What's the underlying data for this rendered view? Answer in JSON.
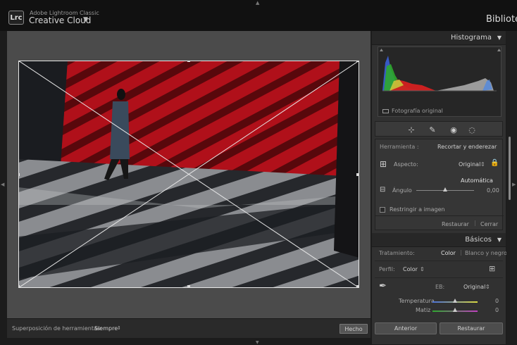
{
  "app": {
    "logo": "Lrc",
    "brand_small": "Adobe Lightroom Classic",
    "brand_main": "Creative Cloud",
    "brand_caret": "▼",
    "module": "Bibliotec"
  },
  "toolbar": {
    "overlay_label": "Superposición de herramientas:",
    "overlay_value": "Siempre",
    "overlay_caret": "⇕",
    "done_label": "Hecho"
  },
  "histogram": {
    "header": "Histograma",
    "caption": "Fotografía original",
    "colors": {
      "red": "#d42020",
      "green": "#2ea82e",
      "blue": "#3b5fd6",
      "yellow": "#c8c83a",
      "gray": "#a8a8a8"
    }
  },
  "tools": {
    "icons": [
      "crop-icon",
      "heal-icon",
      "redeye-icon",
      "mask-icon"
    ]
  },
  "crop": {
    "tool_label": "Herramienta :",
    "tool_value": "Recortar y enderezar",
    "aspect_label": "Aspecto:",
    "aspect_value": "Original",
    "aspect_caret": "⇕",
    "auto_label": "Automática",
    "angle_label": "Ángulo",
    "angle_value": "0,00",
    "angle_fraction": 0.5,
    "restrict_label": "Restringir a imagen",
    "reset_label": "Restaurar",
    "close_label": "Cerrar"
  },
  "basics": {
    "header": "Básicos",
    "treatment_label": "Tratamiento:",
    "treatment_color": "Color",
    "treatment_bw": "Blanco y negro",
    "profile_label": "Perfil:",
    "profile_value": "Color",
    "profile_caret": "⇕",
    "wb_label": "EB:",
    "wb_value": "Original",
    "wb_caret": "⇕",
    "temp_label": "Temperatura",
    "temp_value": "0",
    "tint_label": "Matiz",
    "tint_value": "0"
  },
  "bottom": {
    "previous_label": "Anterior",
    "reset_label": "Restaurar"
  },
  "colors": {
    "accent_wall": "#a80f14",
    "panel_bg": "#313131",
    "canvas_bg": "#4b4b4b"
  }
}
